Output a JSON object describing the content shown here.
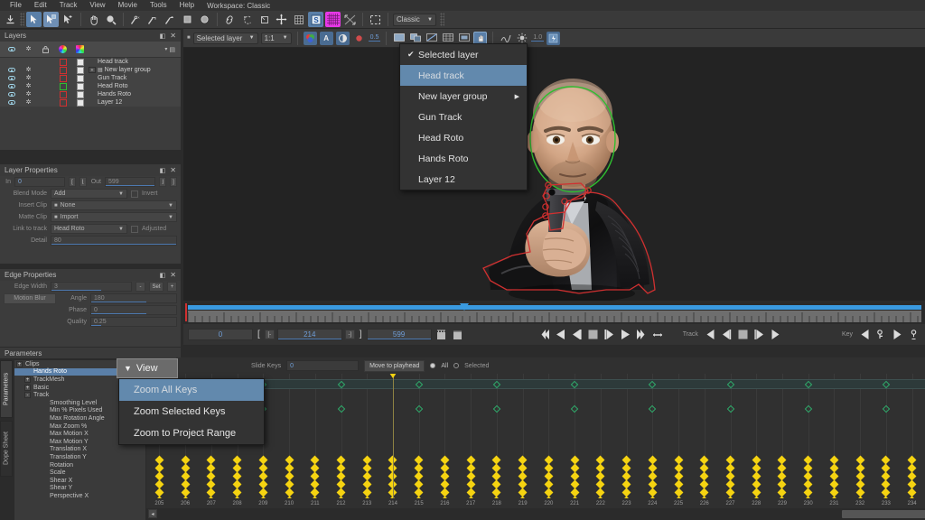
{
  "menubar": {
    "items": [
      "File",
      "Edit",
      "Track",
      "View",
      "Movie",
      "Tools",
      "Help"
    ],
    "workspace": "Workspace: Classic"
  },
  "toolbar": {
    "preset": "Classic",
    "icons": [
      "export-icon",
      "select-arrow-icon",
      "select-add-icon",
      "select-point-icon",
      "pan-hand-icon",
      "zoom-magnifier-icon",
      "create-xspline-icon",
      "create-bspline-icon",
      "create-magnetic-icon",
      "create-rect-icon",
      "create-ellipse-icon",
      "link-icon",
      "reshape-icon",
      "transform-icon",
      "move-icon",
      "mesh-icon",
      "stabilize-icon",
      "grid-icon",
      "warp-icon",
      "marquee-icon"
    ]
  },
  "viewtoolbar": {
    "layer_selector": "Selected layer",
    "zoom_level": "1:1",
    "opacity": "0.5",
    "gain": "1.0",
    "icons": [
      "rgb-channels-icon",
      "alpha-icon",
      "matte-icon",
      "onion-skin-icon",
      "view-single-icon",
      "view-split-icon",
      "view-curve-icon",
      "view-grid-icon",
      "view-layers-icon",
      "pointer-overlay-icon",
      "curve-editor-icon",
      "brightness-icon",
      "light-toggle-icon"
    ]
  },
  "layers_panel": {
    "title": "Layers",
    "column_icons": [
      "visibility-eye-icon",
      "settings-gear-icon",
      "lock-icon",
      "outline-color-icon",
      "fill-color-icon",
      "menu-icon"
    ],
    "rows": [
      {
        "name": "Head  track",
        "visible": false,
        "gear": false,
        "outline": "#d03030",
        "fill": "#e8e8e8",
        "group": false,
        "expand": false
      },
      {
        "name": "New layer group",
        "visible": true,
        "gear": true,
        "outline": "#d03030",
        "fill": "#e8e8e8",
        "group": true,
        "expand": true
      },
      {
        "name": "Gun Track",
        "visible": true,
        "gear": true,
        "outline": "#d03030",
        "fill": "#e8e8e8",
        "group": false,
        "expand": false
      },
      {
        "name": "Head Roto",
        "visible": true,
        "gear": true,
        "outline": "#2fbf2f",
        "fill": "#e8e8e8",
        "group": false,
        "expand": false
      },
      {
        "name": "Hands Roto",
        "visible": true,
        "gear": true,
        "outline": "#d03030",
        "fill": "#e8e8e8",
        "group": false,
        "expand": false
      },
      {
        "name": "Layer 12",
        "visible": true,
        "gear": true,
        "outline": "#d03030",
        "fill": "#e8e8e8",
        "group": false,
        "expand": false
      }
    ]
  },
  "layer_properties": {
    "title": "Layer Properties",
    "in_label": "In",
    "in_value": "0",
    "out_label": "Out",
    "out_value": "599",
    "blend_mode_label": "Blend Mode",
    "blend_mode_value": "Add",
    "invert_label": "Invert",
    "insert_clip_label": "Insert Clip",
    "insert_clip_value": "None",
    "matte_clip_label": "Matte Clip",
    "matte_clip_value": "Import",
    "link_to_track_label": "Link to track",
    "link_to_track_value": "Head Roto",
    "adjusted_label": "Adjusted",
    "detail_label": "Detail",
    "detail_value": "80"
  },
  "edge_properties": {
    "title": "Edge Properties",
    "edge_width_label": "Edge Width",
    "edge_width_value": "3",
    "set_label": "Set",
    "motion_blur_label": "Motion Blur",
    "angle_label": "Angle",
    "angle_value": "180",
    "phase_label": "Phase",
    "phase_value": "0",
    "quality_label": "Quality",
    "quality_value": "0.25"
  },
  "parameters": {
    "title": "Parameters",
    "vertical_tabs": [
      "Parameters",
      "Dope Sheet"
    ],
    "tree": [
      {
        "label": "Clips",
        "indent": 0,
        "expander": "+",
        "selected": false
      },
      {
        "label": "Hands Roto",
        "indent": 1,
        "expander": "",
        "selected": true
      },
      {
        "label": "TrackMesh",
        "indent": 1,
        "expander": "+",
        "selected": false
      },
      {
        "label": "Basic",
        "indent": 1,
        "expander": "+",
        "selected": false
      },
      {
        "label": "Track",
        "indent": 1,
        "expander": "-",
        "selected": false
      },
      {
        "label": "Smoothing Level",
        "indent": 3,
        "expander": "",
        "selected": false
      },
      {
        "label": "Min % Pixels Used",
        "indent": 3,
        "expander": "",
        "selected": false
      },
      {
        "label": "Max Rotation Angle",
        "indent": 3,
        "expander": "",
        "selected": false
      },
      {
        "label": "Max Zoom %",
        "indent": 3,
        "expander": "",
        "selected": false
      },
      {
        "label": "Max Motion X",
        "indent": 3,
        "expander": "",
        "selected": false
      },
      {
        "label": "Max Motion Y",
        "indent": 3,
        "expander": "",
        "selected": false
      },
      {
        "label": "Translation X",
        "indent": 3,
        "expander": "",
        "selected": false
      },
      {
        "label": "Translation Y",
        "indent": 3,
        "expander": "",
        "selected": false
      },
      {
        "label": "Rotation",
        "indent": 3,
        "expander": "",
        "selected": false
      },
      {
        "label": "Scale",
        "indent": 3,
        "expander": "",
        "selected": false
      },
      {
        "label": "Shear X",
        "indent": 3,
        "expander": "",
        "selected": false
      },
      {
        "label": "Shear Y",
        "indent": 3,
        "expander": "",
        "selected": false
      },
      {
        "label": "Perspective X",
        "indent": 3,
        "expander": "",
        "selected": false
      }
    ]
  },
  "layer_menu": {
    "items": [
      {
        "label": "Selected layer",
        "checked": true,
        "highlighted": false,
        "submenu": false
      },
      {
        "label": "Head  track",
        "checked": false,
        "highlighted": true,
        "submenu": false
      },
      {
        "label": "New layer group",
        "checked": false,
        "highlighted": false,
        "submenu": true
      },
      {
        "label": "Gun Track",
        "checked": false,
        "highlighted": false,
        "submenu": false
      },
      {
        "label": "Head Roto",
        "checked": false,
        "highlighted": false,
        "submenu": false
      },
      {
        "label": "Hands Roto",
        "checked": false,
        "highlighted": false,
        "submenu": false
      },
      {
        "label": "Layer 12",
        "checked": false,
        "highlighted": false,
        "submenu": false
      }
    ]
  },
  "view_menu": {
    "button_label": "View",
    "items": [
      {
        "label": "Zoom All Keys",
        "highlighted": true
      },
      {
        "label": "Zoom Selected Keys",
        "highlighted": false
      },
      {
        "label": "Zoom to Project Range",
        "highlighted": false
      }
    ]
  },
  "transport": {
    "current_frame": "0",
    "in_point": "214",
    "out_point": "599",
    "track_label": "Track",
    "key_label": "Key",
    "buttons": [
      "go-to-start-icon",
      "play-backward-icon",
      "step-backward-icon",
      "stop-icon",
      "step-forward-icon",
      "play-forward-icon",
      "go-to-end-icon",
      "loop-icon"
    ],
    "track_buttons": [
      "track-back-icon",
      "track-step-back-icon",
      "track-stop-icon",
      "track-step-fwd-icon",
      "track-fwd-icon"
    ],
    "key_buttons": [
      "key-prev-icon",
      "key-add-icon",
      "key-next-icon",
      "key-all-icon"
    ]
  },
  "dope_toolbar": {
    "slide_keys_label": "Slide Keys",
    "slide_keys_value": "0",
    "move_to_playhead_label": "Move to  playhead",
    "all_label": "All",
    "selected_label": "Selected",
    "all_selected": true
  },
  "dope_sheet": {
    "frame_start": 205,
    "frame_end": 234,
    "playhead_frame": 214,
    "green_key_frames_row1": [
      205,
      209,
      212,
      215,
      218,
      221,
      224,
      227,
      230,
      233
    ],
    "green_key_frames_row2": [
      205,
      209,
      212,
      215,
      218,
      221,
      224,
      227,
      230,
      233
    ],
    "yellow_key_frames": [
      205,
      206,
      207,
      208,
      209,
      210,
      211,
      212,
      213,
      214,
      215,
      216,
      217,
      218,
      219,
      220,
      221,
      222,
      223,
      224,
      225,
      226,
      227,
      228,
      229,
      230,
      231,
      232,
      233,
      234
    ],
    "yellow_rows": 7
  },
  "colors": {
    "accent_blue": "#5a7fa8",
    "highlight_blue": "#6289ad",
    "keyframe_yellow": "#f5d311",
    "keyframe_green": "#2faa6a",
    "roto_red": "#d03030",
    "roto_green": "#2fbf2f",
    "panel_bg": "#3c3c3c",
    "app_bg": "#2b2b2b"
  }
}
